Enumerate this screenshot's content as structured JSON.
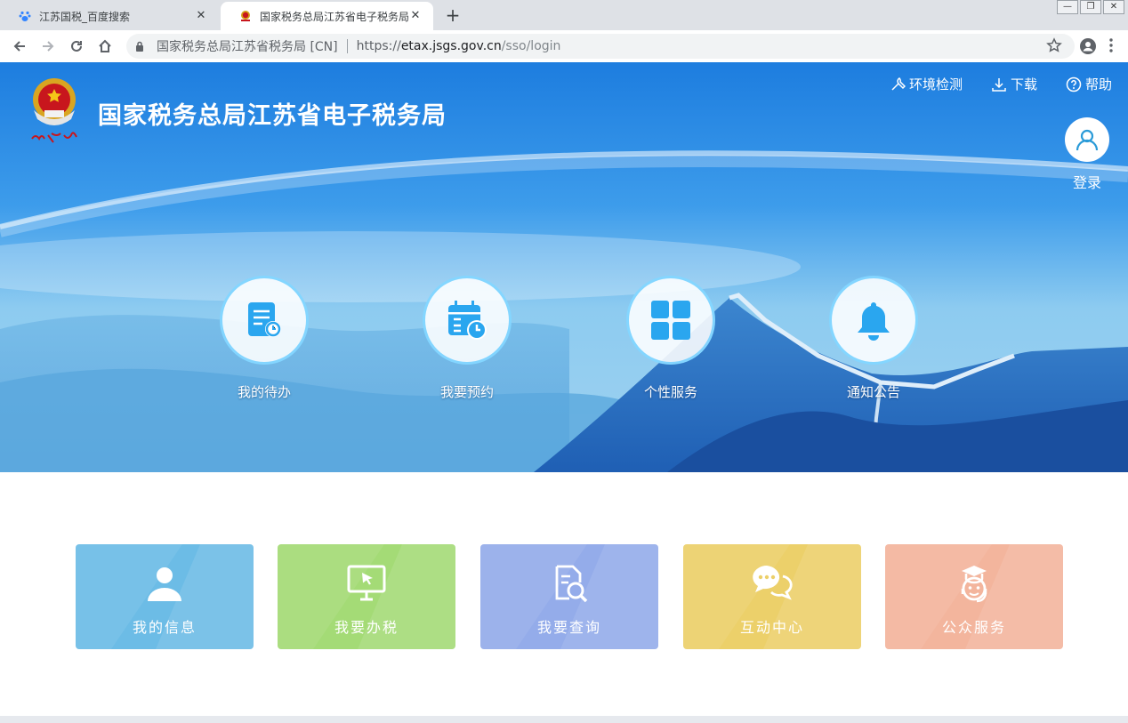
{
  "browser": {
    "tabs": [
      {
        "title": "江苏国税_百度搜索",
        "favicon": "baidu-paw-icon",
        "active": false
      },
      {
        "title": "国家税务总局江苏省电子税务局",
        "favicon": "tax-emblem-icon",
        "active": true
      }
    ],
    "new_tab_label": "+",
    "close_label": "✕",
    "address": {
      "site_name": "国家税务总局江苏省税务局 [CN]",
      "scheme": "https://",
      "host": "etax.jsgs.gov.cn",
      "path": "/sso/login"
    }
  },
  "header": {
    "site_title": "国家税务总局江苏省电子税务局",
    "links": [
      {
        "label": "环境检测",
        "icon": "wrench-icon"
      },
      {
        "label": "下载",
        "icon": "download-icon"
      },
      {
        "label": "帮助",
        "icon": "help-icon"
      }
    ],
    "login_label": "登录"
  },
  "features": [
    {
      "label": "我的待办",
      "icon": "document-clock-icon"
    },
    {
      "label": "我要预约",
      "icon": "calendar-clock-icon"
    },
    {
      "label": "个性服务",
      "icon": "grid-icon"
    },
    {
      "label": "通知公告",
      "icon": "bell-icon"
    }
  ],
  "cards": [
    {
      "label": "我的信息",
      "icon": "user-icon",
      "color": "#6cbce6"
    },
    {
      "label": "我要办税",
      "icon": "monitor-cursor-icon",
      "color": "#a4db76"
    },
    {
      "label": "我要查询",
      "icon": "document-search-icon",
      "color": "#94acea"
    },
    {
      "label": "互动中心",
      "icon": "chat-icon",
      "color": "#ecd06a"
    },
    {
      "label": "公众服务",
      "icon": "support-agent-icon",
      "color": "#f3b59d"
    }
  ],
  "colors": {
    "hero_top": "#1e7fe0",
    "hero_mid": "#86c8ef",
    "feature_icon": "#2aa6ef"
  }
}
